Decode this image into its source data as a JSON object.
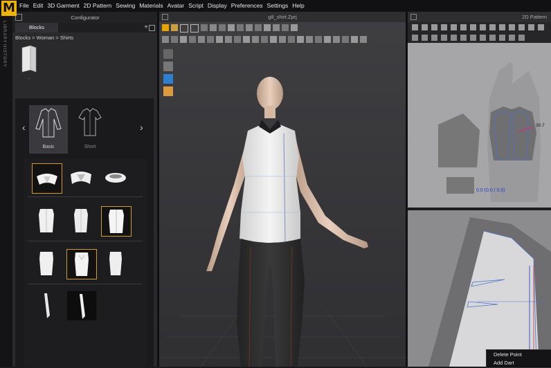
{
  "app": {
    "logo_letter": "M",
    "menu": [
      "File",
      "Edit",
      "3D Garment",
      "2D Pattern",
      "Sewing",
      "Materials",
      "Avatar",
      "Script",
      "Display",
      "Preferences",
      "Settings",
      "Help"
    ],
    "side_tabs": [
      "LIBRARY",
      "HISTORY"
    ]
  },
  "configurator": {
    "title": "Configurator",
    "tab": "Blocks",
    "breadcrumb": "Blocks > Woman > Shirts",
    "file_label": "..",
    "categories": [
      {
        "label": "Basic",
        "selected": true
      },
      {
        "label": "Short",
        "selected": false
      }
    ]
  },
  "viewport3d": {
    "title": "g8_shirt.Zprj"
  },
  "pattern2d": {
    "title": "2D Pattern",
    "coord_readout": "0.0 (0.0 / 0.0)",
    "measure_label": "30.7"
  },
  "context_menu": {
    "items": [
      "Delete Point",
      "Add Dart"
    ]
  },
  "colors": {
    "accent": "#d49b1e",
    "logo_bg": "#f0b400",
    "coord_text": "#1e3ad6",
    "stitch_line": "#4a70c8",
    "measure_highlight": "#e0208a"
  }
}
